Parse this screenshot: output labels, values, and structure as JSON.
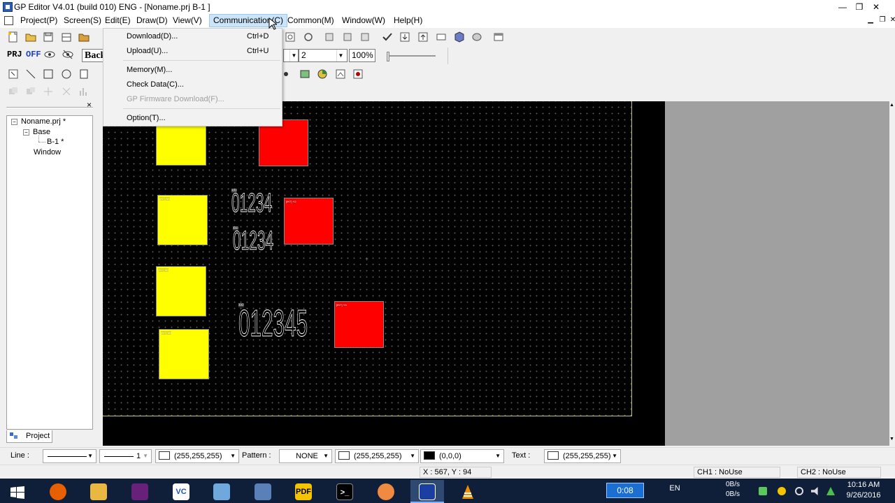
{
  "window": {
    "title": "GP Editor V4.01 (build 010) ENG - [Noname.prj B-1 ]",
    "minimize": "—",
    "maximize": "❐",
    "close": "✕"
  },
  "menubar": {
    "items": [
      "Project(P)",
      "Screen(S)",
      "Edit(E)",
      "Draw(D)",
      "View(V)",
      "Communication(C)",
      "Common(M)",
      "Window(W)",
      "Help(H)"
    ],
    "active": "Communication(C)"
  },
  "toolbar": {
    "prj": "PRJ",
    "off": "OFF",
    "back_text": "Back",
    "line_width_value": "2",
    "zoom_value": "100%"
  },
  "communication_menu": {
    "items": [
      {
        "label": "Download(D)...",
        "shortcut": "Ctrl+D",
        "enabled": true
      },
      {
        "label": "Upload(U)...",
        "shortcut": "Ctrl+U",
        "enabled": true
      },
      {
        "label": "Memory(M)...",
        "shortcut": "",
        "enabled": true
      },
      {
        "label": "Check Data(C)...",
        "shortcut": "",
        "enabled": true
      },
      {
        "label": "GP Firmware Download(F)...",
        "shortcut": "",
        "enabled": false
      },
      {
        "label": "Option(T)...",
        "shortcut": "",
        "enabled": true
      }
    ]
  },
  "project_panel": {
    "tree": [
      {
        "label": "Noname.prj *",
        "depth": 0,
        "expander": "−"
      },
      {
        "label": "Base",
        "depth": 1,
        "expander": "−"
      },
      {
        "label": "B-1 *",
        "depth": 2,
        "expander": ""
      },
      {
        "label": "Window",
        "depth": 1,
        "expander": ""
      }
    ],
    "tab_label": "Project",
    "close_glyph": "×"
  },
  "canvas": {
    "colors": {
      "background": "#000000",
      "lamp_yellow": "#ffff00",
      "lamp_red": "#ff0000",
      "margin": "#a0a0a0"
    },
    "numeric_displays": [
      {
        "text": "01234",
        "tag": "00000"
      },
      {
        "text": "01234",
        "tag": "00000"
      },
      {
        "text": "012345",
        "tag": "00000"
      }
    ],
    "lamp_tags": [
      "[INT] M1",
      "[INT] M2",
      "[INT] M3",
      "[INT] Y1",
      "[INT] Y2",
      "[INT] Y3"
    ]
  },
  "property_bar": {
    "line_label": "Line :",
    "line_width": "1",
    "line_color": "(255,255,255)",
    "pattern_label": "Pattern :",
    "pattern_value": "NONE",
    "fg_color": "(255,255,255)",
    "bg_color": "(0,0,0)",
    "text_label": "Text :",
    "text_color": "(255,255,255)"
  },
  "statusbar": {
    "coords": "X : 567, Y : 94",
    "ch1": "CH1 : NoUse",
    "ch2": "CH2 : NoUse"
  },
  "taskbar": {
    "apps": [
      "windows-start",
      "firefox",
      "file-explorer",
      "visual-studio",
      "vc",
      "paint",
      "network-app",
      "pdf",
      "cmd",
      "app-orange",
      "gp-editor",
      "vlc"
    ],
    "timer": "0:08",
    "lang": "EN",
    "net_up": "0B/s",
    "net_down": "0B/s",
    "time": "10:16 AM",
    "date": "9/26/2016"
  }
}
